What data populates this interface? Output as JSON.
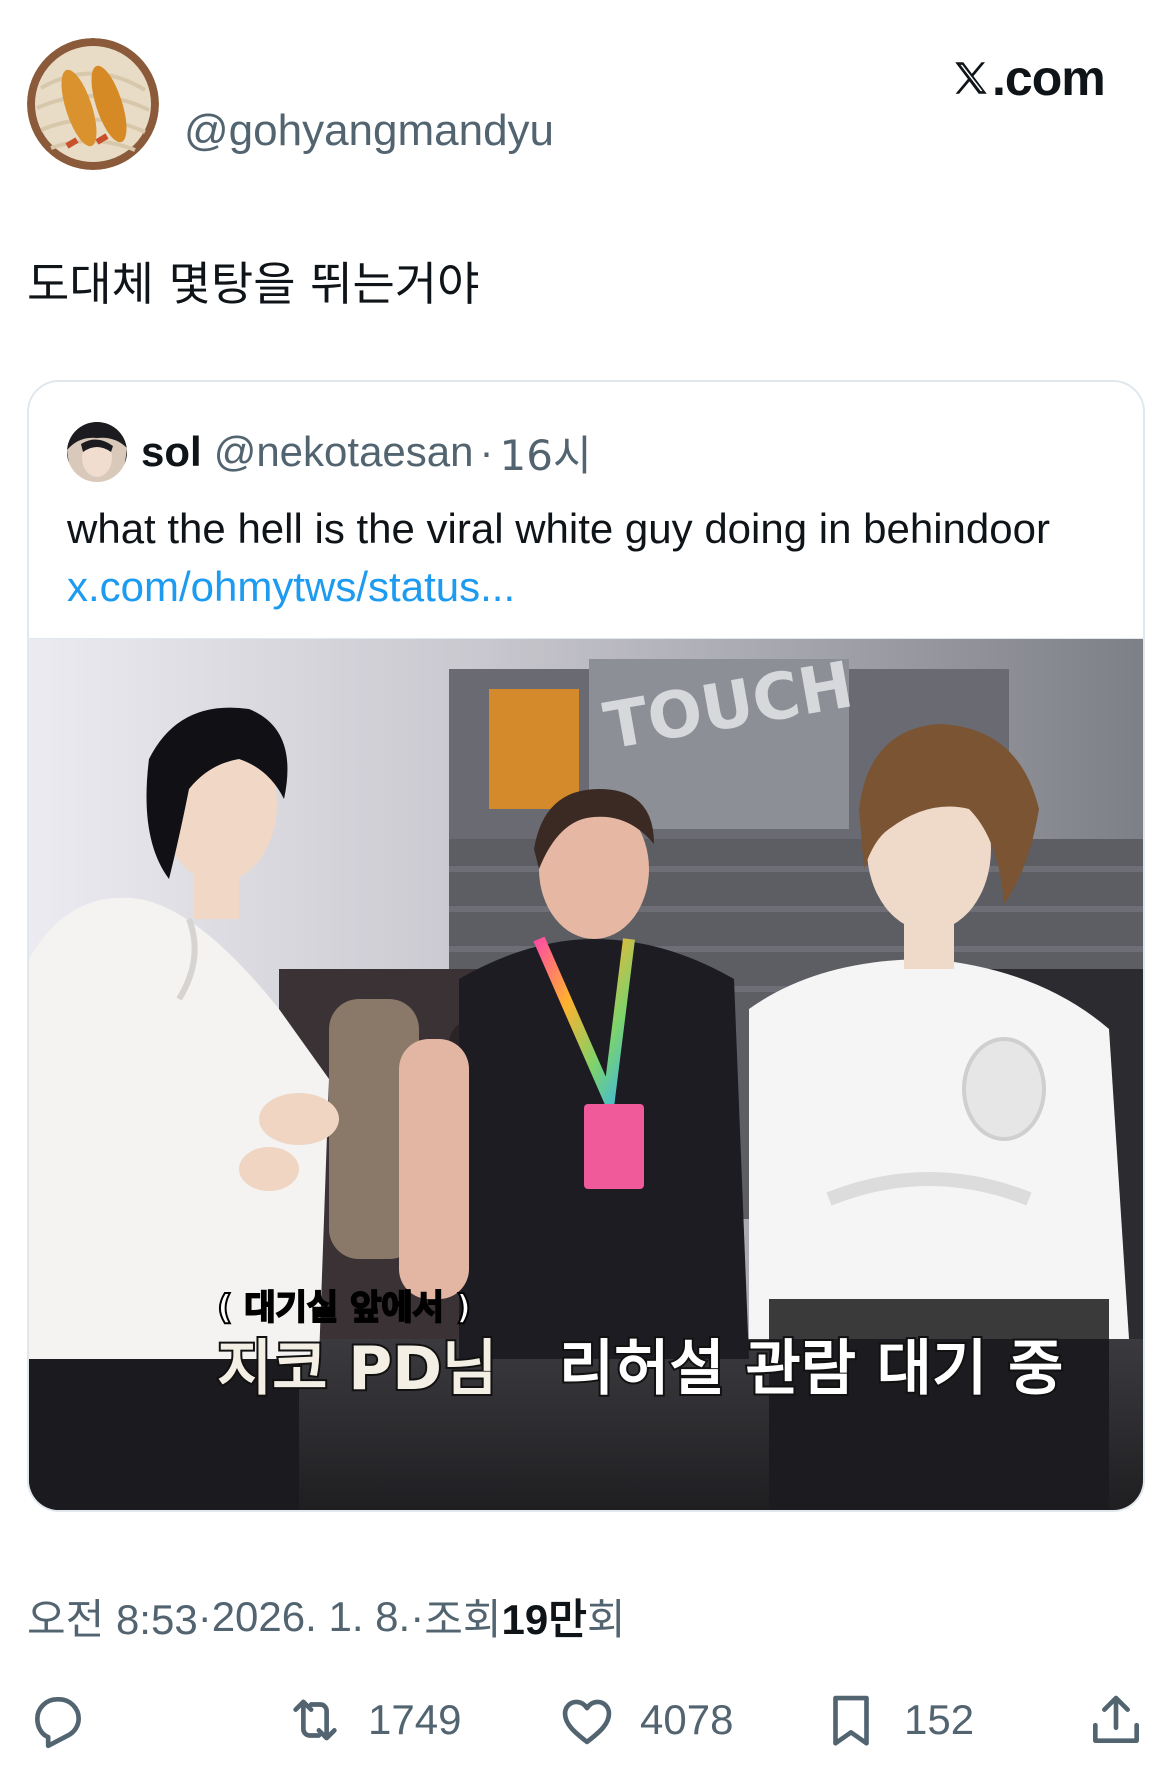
{
  "author": {
    "handle": "@gohyangmandyu"
  },
  "brand": {
    "text": ".com"
  },
  "tweet": {
    "text": "도대체 몇탕을 뛰는거야"
  },
  "quote": {
    "name": "sol",
    "handle": "@nekotaesan",
    "separator": "·",
    "time": "16시",
    "text": "what the hell is the viral white guy doing in behindoor ",
    "link": "x.com/ohmytws/status...",
    "media": {
      "sign_text": "TOUCH",
      "caption_small": "( 대기실 앞에서 )",
      "caption_main_a": "지코 PD님",
      "caption_main_b": "리허설 관람 대기 중"
    }
  },
  "meta": {
    "time": "오전 8:53",
    "sep1": " · ",
    "date": "2026. 1. 8.",
    "sep2": " · ",
    "views_label": "조회 ",
    "views_value": "19만",
    "views_suffix": "회"
  },
  "actions": {
    "retweets": "1749",
    "likes": "4078",
    "bookmarks": "152"
  },
  "colors": {
    "link": "#1d9bf0",
    "secondary": "#536471",
    "text": "#0f1419"
  }
}
